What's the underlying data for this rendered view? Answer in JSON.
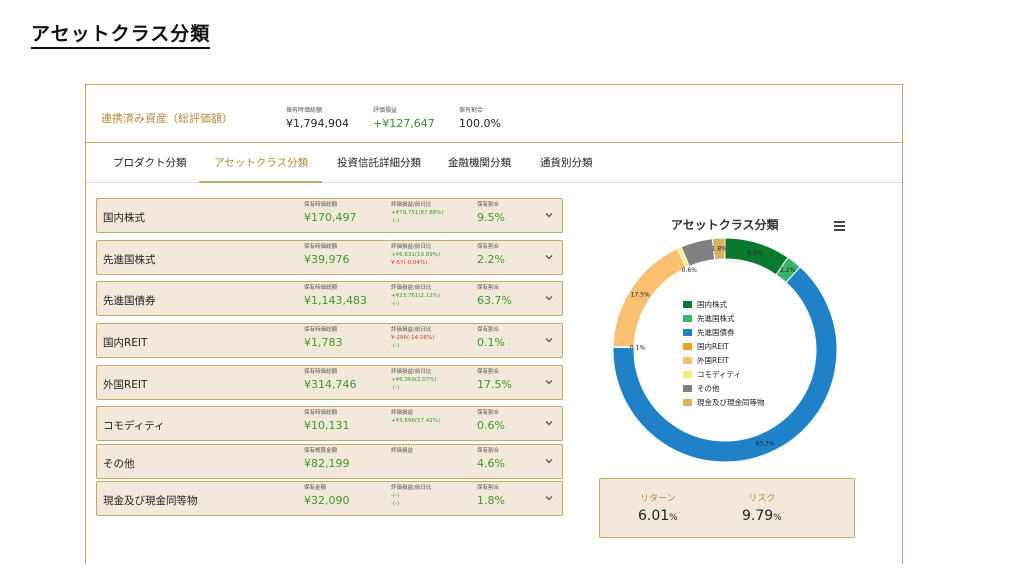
{
  "page_title": "アセットクラス分類",
  "summary": {
    "label": "連携済み資産（総評価額）",
    "items": [
      {
        "caption": "保有時価総額",
        "value": "¥1,794,904"
      },
      {
        "caption": "評価損益",
        "value": "+¥127,647"
      },
      {
        "caption": "保有割合",
        "value": "100.0%"
      }
    ]
  },
  "tabs": [
    "プロダクト分類",
    "アセットクラス分類",
    "投資信託詳細分類",
    "金融機関分類",
    "通貨別分類"
  ],
  "rows": [
    {
      "name": "国内株式",
      "cap1": "保有時価総額",
      "value": "¥170,497",
      "cap2": "評価損益/前日比",
      "line1": "+¥79,751(87.88%)",
      "line2": "-(-)",
      "cap3": "保有割合",
      "share": "9.5%"
    },
    {
      "name": "先進国株式",
      "cap1": "保有時価総額",
      "value": "¥39,976",
      "cap2": "評価損益/前日比",
      "line1": "+¥6,631(19.89%)",
      "line2": "¥-57(-0.04%)",
      "cap3": "保有割合",
      "share": "2.2%"
    },
    {
      "name": "先進国債券",
      "cap1": "保有時価総額",
      "value": "¥1,143,483",
      "cap2": "評価損益/前日比",
      "line1": "+¥23,761(2.12%)",
      "line2": "-(-)",
      "cap3": "保有割合",
      "share": "63.7%"
    },
    {
      "name": "国内REIT",
      "cap1": "保有時価総額",
      "value": "¥1,783",
      "cap2": "評価損益/前日比",
      "line1": "¥-296(-14.26%)",
      "line2": "-(-)",
      "cap3": "保有割合",
      "share": "0.1%"
    },
    {
      "name": "外国REIT",
      "cap1": "保有時価総額",
      "value": "¥314,746",
      "cap2": "評価損益/前日比",
      "line1": "+¥6,369(2.07%)",
      "line2": "-(-)",
      "cap3": "保有割合",
      "share": "17.5%"
    },
    {
      "name": "コモディティ",
      "cap1": "保有時価総額",
      "value": "¥10,131",
      "cap2": "評価損益",
      "line1": "+¥3,696(57.42%)",
      "line2": "",
      "cap3": "保有割合",
      "share": "0.6%"
    },
    {
      "name": "その他",
      "cap1": "保有概算金額",
      "value": "¥82,199",
      "cap2": "評価損益",
      "line1": "-",
      "line2": "",
      "cap3": "保有割合",
      "share": "4.6%"
    },
    {
      "name": "現金及び現金同等物",
      "cap1": "保有金額",
      "value": "¥32,090",
      "cap2": "評価損益/前日比",
      "line1": "-(-)",
      "line2": "-(-)",
      "cap3": "保有割合",
      "share": "1.8%"
    }
  ],
  "row_colors": {
    "positive": "#3a9a2c",
    "negative": "#e0301e"
  },
  "icons": {
    "row_expand": "chevron-down-icon",
    "chart_menu": "hamburger-menu-icon"
  },
  "chart_data": {
    "type": "pie",
    "title": "アセットクラス分類",
    "categories": [
      "国内株式",
      "先進国株式",
      "先進国債券",
      "国内REIT",
      "外国REIT",
      "コモディティ",
      "その他",
      "現金及び現金同等物"
    ],
    "values": [
      9.5,
      2.2,
      63.7,
      0.1,
      17.5,
      0.6,
      4.6,
      1.8
    ],
    "slice_labels": [
      "9.5%",
      "2.2%",
      "63.7%",
      "0.1%",
      "17.5%",
      "0.6%",
      "",
      "1.8%"
    ],
    "colors": [
      "#0b7a30",
      "#3bb36a",
      "#1f82c8",
      "#f0a020",
      "#f8c070",
      "#f8ec80",
      "#808080",
      "#d8b060"
    ],
    "legend_position": "center"
  },
  "metrics": [
    {
      "label": "リターン",
      "value": "6.01",
      "unit": "%"
    },
    {
      "label": "リスク",
      "value": "9.79",
      "unit": "%"
    }
  ]
}
